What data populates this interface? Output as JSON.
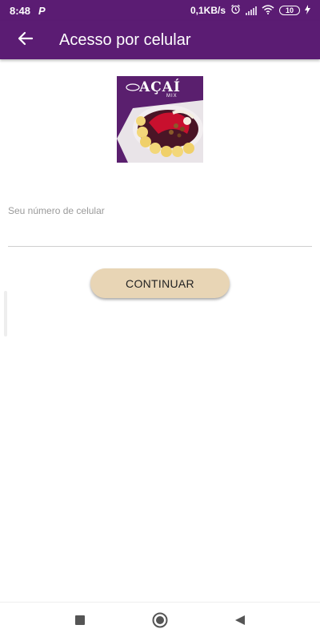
{
  "status_bar": {
    "time": "8:48",
    "notification_icon": "p-icon",
    "network_speed": "0,1KB/s",
    "battery_level": "10",
    "icons": [
      "alarm-icon",
      "signal-icon",
      "wifi-icon",
      "battery-icon",
      "charging-icon"
    ]
  },
  "app_bar": {
    "title": "Acesso por celular",
    "back_icon": "arrow-left-icon",
    "color": "#5b1c73"
  },
  "logo": {
    "brand_text": "AÇAÍ",
    "sub_text": "MIX"
  },
  "form": {
    "phone_label": "Seu número de celular",
    "phone_value": "",
    "continue_label": "CONTINUAR",
    "button_color": "#e8d5b5"
  },
  "nav_bar": {
    "icons": [
      "recents-square-icon",
      "home-circle-icon",
      "back-triangle-icon"
    ]
  }
}
